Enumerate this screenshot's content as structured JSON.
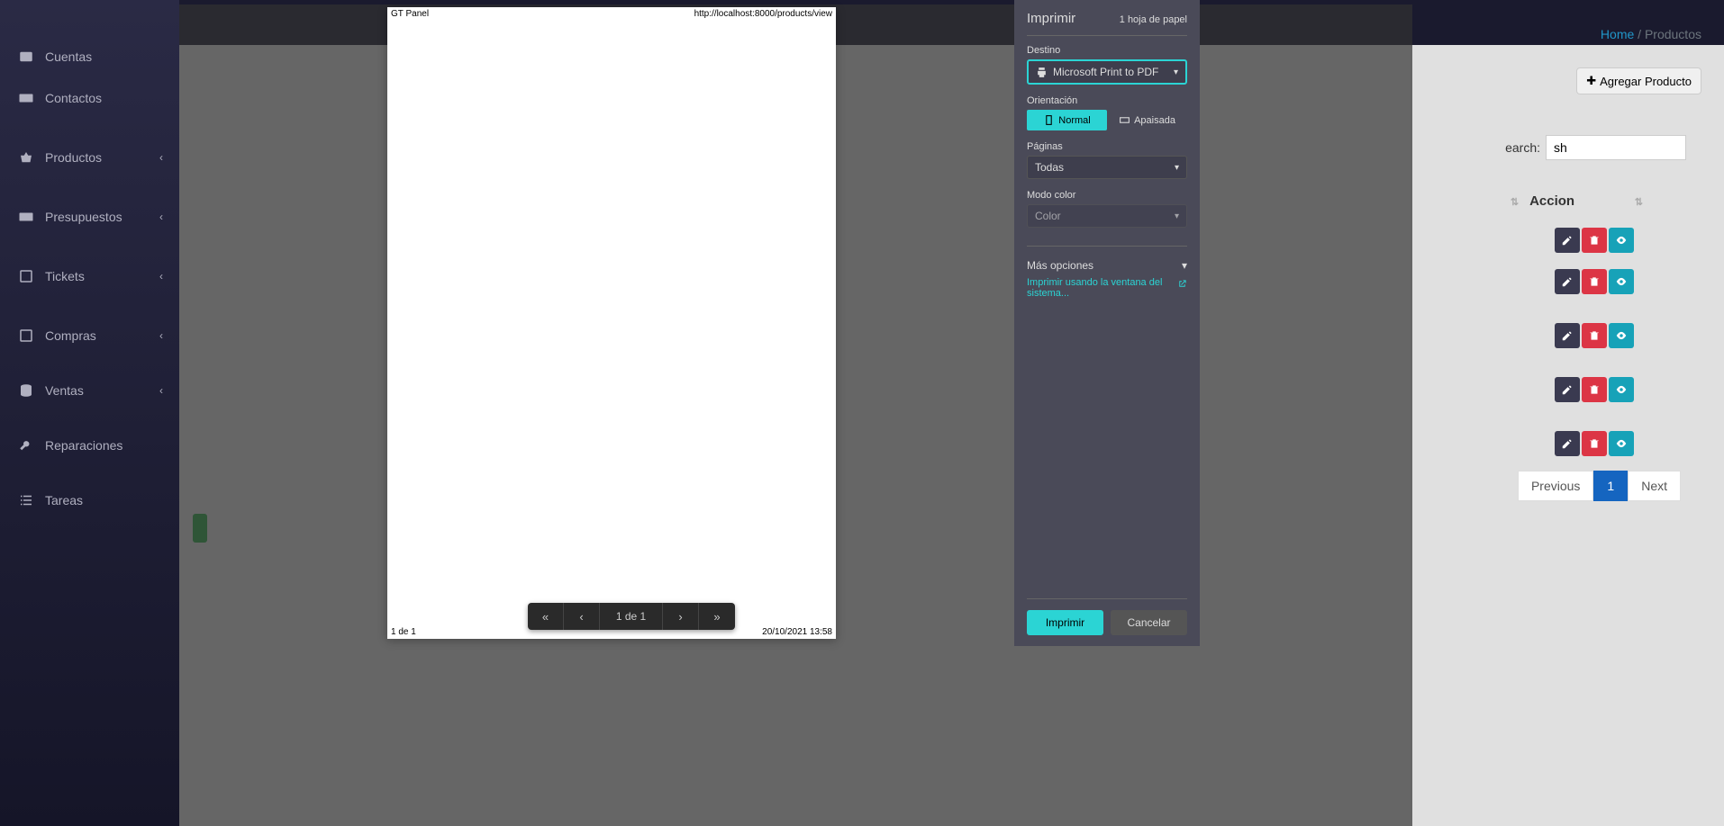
{
  "sidebar": {
    "items": [
      {
        "label": "Cuentas",
        "icon": "users",
        "expandable": false
      },
      {
        "label": "Contactos",
        "icon": "idcard",
        "expandable": false
      },
      {
        "label": "Productos",
        "icon": "basket",
        "expandable": true
      },
      {
        "label": "Presupuestos",
        "icon": "card",
        "expandable": true
      },
      {
        "label": "Tickets",
        "icon": "ticket",
        "expandable": true
      },
      {
        "label": "Compras",
        "icon": "compras",
        "expandable": true
      },
      {
        "label": "Ventas",
        "icon": "db",
        "expandable": true
      },
      {
        "label": "Reparaciones",
        "icon": "wrench",
        "expandable": false
      },
      {
        "label": "Tareas",
        "icon": "list",
        "expandable": false
      }
    ]
  },
  "breadcrumb": {
    "home": "Home",
    "sep": "/",
    "current": "Productos"
  },
  "add_button": "Agregar Producto",
  "search": {
    "label": "earch:",
    "value": "sh"
  },
  "column": {
    "header": "Accion"
  },
  "rows": [
    {},
    {},
    {},
    {},
    {}
  ],
  "pagination": {
    "prev": "Previous",
    "page": "1",
    "next": "Next"
  },
  "preview": {
    "header_left": "GT Panel",
    "header_right": "http://localhost:8000/products/view",
    "footer_left": "1 de 1",
    "footer_right": "20/10/2021 13:58",
    "toolbar_mid": "1 de 1"
  },
  "print_dialog": {
    "title": "Imprimir",
    "sheets": "1 hoja de papel",
    "destination": {
      "label": "Destino",
      "value": "Microsoft Print to PDF"
    },
    "orientation": {
      "label": "Orientación",
      "normal": "Normal",
      "landscape": "Apaisada"
    },
    "pages": {
      "label": "Páginas",
      "value": "Todas"
    },
    "color": {
      "label": "Modo color",
      "value": "Color"
    },
    "more": "Más opciones",
    "system_link": "Imprimir usando la ventana del sistema...",
    "print_btn": "Imprimir",
    "cancel_btn": "Cancelar"
  }
}
